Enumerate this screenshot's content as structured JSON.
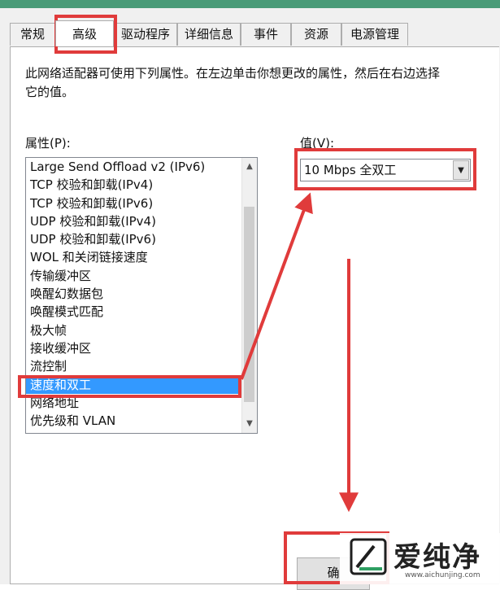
{
  "tabs": [
    {
      "label": "常规"
    },
    {
      "label": "高级"
    },
    {
      "label": "驱动程序"
    },
    {
      "label": "详细信息"
    },
    {
      "label": "事件"
    },
    {
      "label": "资源"
    },
    {
      "label": "电源管理"
    }
  ],
  "active_tab": "高级",
  "description": "此网络适配器可使用下列属性。在左边单击你想更改的属性，然后在右边选择它的值。",
  "property_label": "属性(P):",
  "value_label": "值(V):",
  "properties": [
    {
      "label": "Large Send Offload v2 (IPv6)"
    },
    {
      "label": "TCP 校验和卸载(IPv4)"
    },
    {
      "label": "TCP 校验和卸载(IPv6)"
    },
    {
      "label": "UDP 校验和卸载(IPv4)"
    },
    {
      "label": "UDP 校验和卸载(IPv6)"
    },
    {
      "label": "WOL 和关闭链接速度"
    },
    {
      "label": "传输缓冲区"
    },
    {
      "label": "唤醒幻数据包"
    },
    {
      "label": "唤醒模式匹配"
    },
    {
      "label": "极大帧"
    },
    {
      "label": "接收缓冲区"
    },
    {
      "label": "流控制"
    },
    {
      "label": "速度和双工",
      "selected": true
    },
    {
      "label": "网络地址"
    },
    {
      "label": "优先级和 VLAN"
    }
  ],
  "value_selected": "10 Mbps 全双工",
  "ok_button_label": "确",
  "watermark": {
    "text": "爱纯净",
    "url": "www.aichunjing.com"
  },
  "colors": {
    "highlight": "#e03b3b",
    "selection": "#3399ff",
    "title_strip": "#4a9b78",
    "dialog_bg": "#f0f0f0"
  },
  "icons": {
    "scroll_up": "chevron-up-icon",
    "scroll_down": "chevron-down-icon",
    "combo_dropdown": "dropdown-arrow-icon"
  }
}
